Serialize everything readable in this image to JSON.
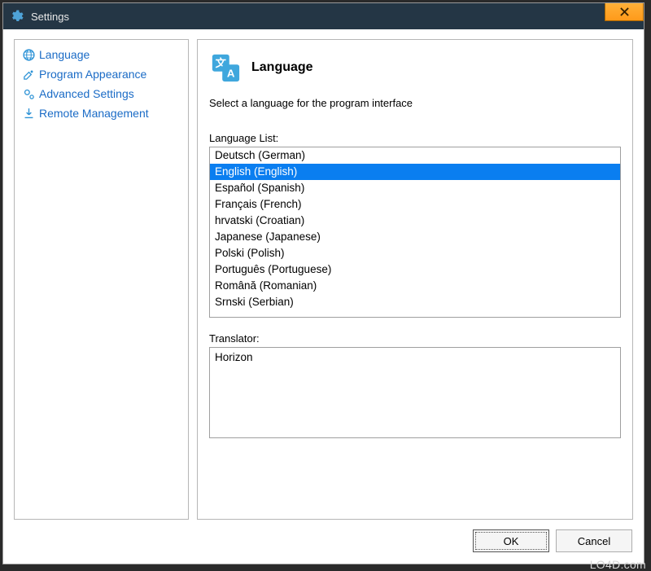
{
  "window": {
    "title": "Settings"
  },
  "sidebar": {
    "items": [
      {
        "label": "Language"
      },
      {
        "label": "Program Appearance"
      },
      {
        "label": "Advanced Settings"
      },
      {
        "label": "Remote Management"
      }
    ]
  },
  "main": {
    "heading": "Language",
    "subtitle": "Select a language for the program interface",
    "languageListLabel": "Language List:",
    "languages": [
      "Deutsch (German)",
      "English (English)",
      "Español (Spanish)",
      "Français (French)",
      "hrvatski (Croatian)",
      "Japanese (Japanese)",
      "Polski (Polish)",
      "Português (Portuguese)",
      "Română (Romanian)",
      "Srnski (Serbian)"
    ],
    "selectedIndex": 1,
    "translatorLabel": "Translator:",
    "translator": "Horizon"
  },
  "buttons": {
    "ok": "OK",
    "cancel": "Cancel"
  },
  "watermark": "LO4D.com"
}
